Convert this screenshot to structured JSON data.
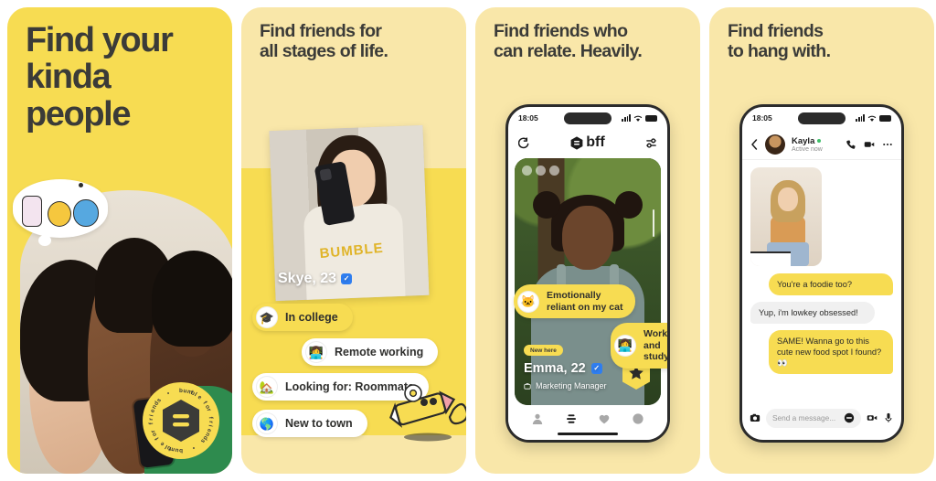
{
  "gallery": {
    "panels": [
      {
        "id": "panel-1",
        "headline": "Find your\nkinda\npeople",
        "background_color": "#F7DC52",
        "badge": {
          "ring_text": "bumble for friends  •  bumble for friends  •  ",
          "logo": "bumble-hexagon-logo"
        },
        "illustration": "thought-bubble-cartoon-characters",
        "photo_alt": "three-friends-taking-selfie"
      },
      {
        "id": "panel-2",
        "headline": "Find friends for\nall stages of life.",
        "background_color": "#F9E7A9",
        "profile": {
          "name_age": "Skye, 23",
          "verified": true,
          "photo_alt": "woman-in-bumble-sweatshirt-mirror-selfie"
        },
        "pills": [
          {
            "label": "In college",
            "icon": "graduation-cap-icon",
            "glyph": "🎓",
            "style": "yellow"
          },
          {
            "label": "Remote working",
            "icon": "person-laptop-icon",
            "glyph": "👩‍💻",
            "style": "white"
          },
          {
            "label": "Looking for: Roommate",
            "icon": "house-icon",
            "glyph": "🏡",
            "style": "white"
          },
          {
            "label": "New to town",
            "icon": "globe-icon",
            "glyph": "🌎",
            "style": "white"
          }
        ],
        "mascot": "pencil-character-peace-sign"
      },
      {
        "id": "panel-3",
        "headline": "Find friends who\ncan relate. Heavily.",
        "background_color": "#F9E7A9",
        "phone": {
          "status_time": "18:05",
          "app_name": "bff",
          "back_icon": "back-arrow-icon",
          "filter_icon": "filters-icon",
          "profile": {
            "badge": "New here",
            "name_age": "Emma, 22",
            "verified": true,
            "job": "Marketing Manager",
            "job_icon": "briefcase-icon",
            "photo_alt": "woman-with-space-buns-outdoors-under-tree"
          },
          "pills": [
            {
              "label": "Emotionally\nreliant on my cat",
              "icon": "cat-icon",
              "glyph": "🐱",
              "style": "yellow"
            },
            {
              "label": "Working\nand studying",
              "icon": "person-laptop-icon",
              "glyph": "👩‍💻",
              "style": "yellow"
            }
          ],
          "super_swipe_icon": "star-hexagon-icon",
          "nav": [
            {
              "icon": "profile-icon",
              "active": false
            },
            {
              "icon": "bff-hive-icon",
              "active": true
            },
            {
              "icon": "heart-icon",
              "active": false
            },
            {
              "icon": "chats-icon",
              "active": false
            }
          ]
        }
      },
      {
        "id": "panel-4",
        "headline": "Find friends\nto hang with.",
        "background_color": "#F9E7A9",
        "phone": {
          "status_time": "18:05",
          "chat": {
            "back_icon": "back-arrow-icon",
            "contact_name": "Kayla",
            "status": "Active now",
            "online": true,
            "actions": [
              {
                "icon": "phone-call-icon"
              },
              {
                "icon": "video-camera-icon"
              },
              {
                "icon": "more-options-icon"
              }
            ],
            "shared_photo_alt": "woman-eating-sandwich",
            "messages": [
              {
                "from": "me",
                "text": "You're a foodie too?"
              },
              {
                "from": "them",
                "text": "Yup, i'm lowkey obsessed!"
              },
              {
                "from": "me",
                "text": "SAME! Wanna go to this cute new food spot I found?  👀"
              }
            ],
            "input_placeholder": "Send a message...",
            "input_value": "",
            "composer_icons": [
              {
                "icon": "camera-icon"
              },
              {
                "icon": "emoji-icon"
              },
              {
                "icon": "video-message-icon"
              },
              {
                "icon": "microphone-icon"
              }
            ]
          }
        }
      }
    ]
  },
  "colors": {
    "brand_yellow": "#F7DC52",
    "cream": "#F9E7A9",
    "ink": "#3B3B38",
    "verified_blue": "#2F7EF0",
    "online_green": "#3FBF6A"
  }
}
